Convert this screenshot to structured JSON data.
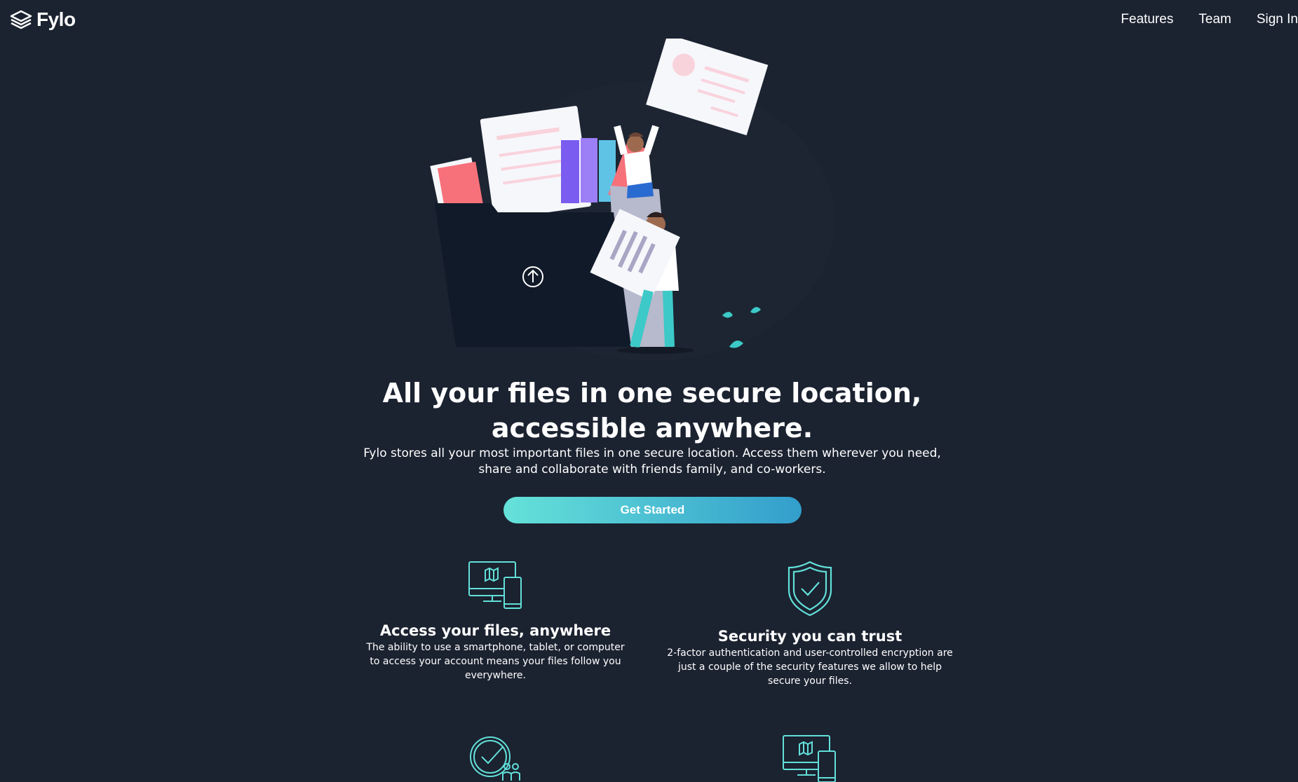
{
  "nav": {
    "brand": "Fylo",
    "links": [
      {
        "label": "Features"
      },
      {
        "label": "Team"
      },
      {
        "label": "Sign In"
      }
    ]
  },
  "hero": {
    "title": "All your files in one secure location, accessible anywhere.",
    "description": "Fylo stores all your most important files in one secure location. Access them wherever you need, share and collaborate with friends family, and co-workers.",
    "cta_label": "Get Started"
  },
  "features": [
    {
      "icon": "devices-icon",
      "title": "Access your files, anywhere",
      "text": "The ability to use a smartphone, tablet, or computer to access your account means your files follow you everywhere."
    },
    {
      "icon": "shield-check-icon",
      "title": "Security you can trust",
      "text": "2-factor authentication and user-controlled encryption are just a couple of the security features we allow to help secure your files."
    },
    {
      "icon": "collaboration-icon",
      "title": "",
      "text": ""
    },
    {
      "icon": "devices-icon",
      "title": "",
      "text": ""
    }
  ],
  "colors": {
    "background": "#1b2230",
    "accent_start": "#65e2d9",
    "accent_end": "#339ecc",
    "icon_stroke": "#62e0d9"
  }
}
